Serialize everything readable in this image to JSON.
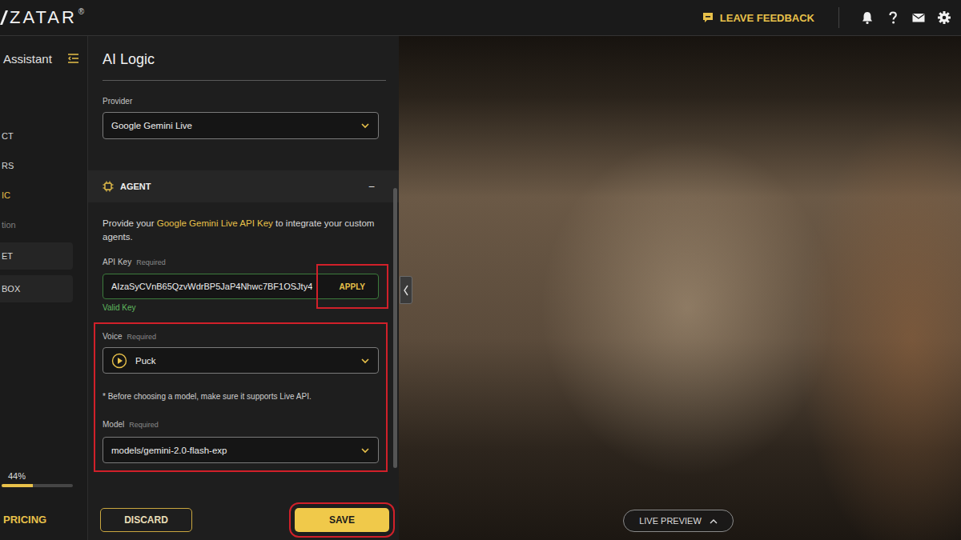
{
  "logo": {
    "text": "ZATAR",
    "mark": "®"
  },
  "topbar": {
    "feedback": "LEAVE FEEDBACK"
  },
  "sidebar": {
    "title": "Assistant",
    "items": [
      {
        "label": "CT",
        "kind": "link",
        "selected": false,
        "disabled": false
      },
      {
        "label": "RS",
        "kind": "link",
        "selected": false,
        "disabled": false
      },
      {
        "label": "IC",
        "kind": "link",
        "selected": true,
        "disabled": false
      },
      {
        "label": "tion",
        "kind": "link",
        "selected": false,
        "disabled": true
      },
      {
        "label": "ET",
        "kind": "box",
        "selected": false,
        "disabled": false
      },
      {
        "label": "BOX",
        "kind": "box",
        "selected": false,
        "disabled": false
      }
    ],
    "progress": {
      "reading": "44%",
      "level": 0.44
    },
    "pricing": "PRICING"
  },
  "panel": {
    "title": "AI Logic",
    "provider": {
      "label": "Provider",
      "value": "Google Gemini Live"
    },
    "agent": {
      "title": "AGENT",
      "toggle": "−",
      "intro": {
        "before": "Provide your ",
        "link": "Google Gemini Live API Key",
        "after": " to integrate your custom agents."
      },
      "api_key": {
        "label": "API Key",
        "required": "Required",
        "value": "AIzaSyCVnB65QzvWdrBP5JaP4Nhwc7BF1OSJty4",
        "apply": "APPLY",
        "apply_highlighted": true,
        "status": "Valid Key",
        "valid": true
      },
      "settings_highlighted": true,
      "voice": {
        "label": "Voice",
        "required": "Required",
        "value": "Puck"
      },
      "note": "* Before choosing a model, make sure it supports Live API.",
      "model": {
        "label": "Model",
        "required": "Required",
        "value": "models/gemini-2.0-flash-exp"
      }
    },
    "buttons": [
      {
        "label": "DISCARD",
        "kind": "outline",
        "highlighted": false
      },
      {
        "label": "SAVE",
        "kind": "primary",
        "highlighted": true
      }
    ]
  },
  "preview": {
    "label": "LIVE PREVIEW"
  }
}
